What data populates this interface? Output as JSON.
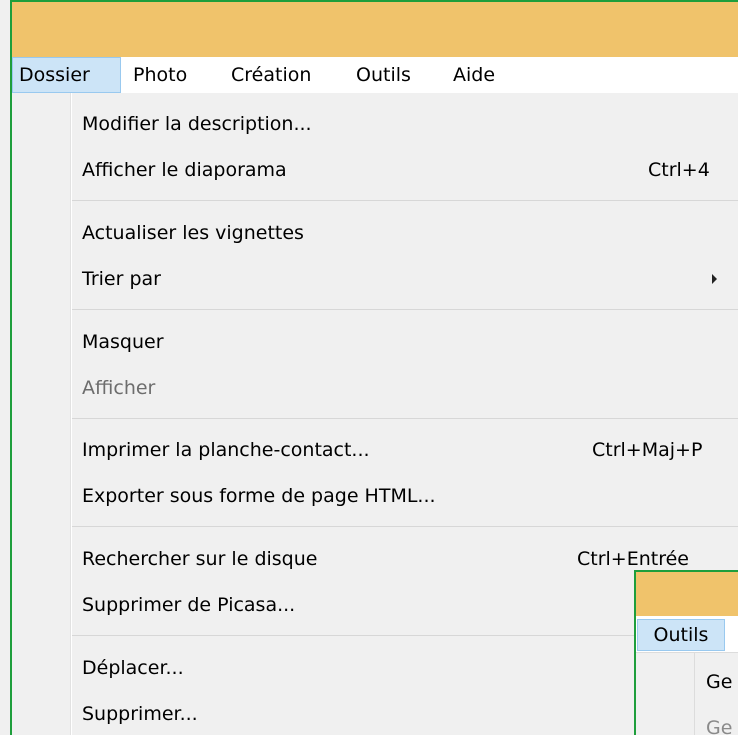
{
  "menubar": {
    "items": [
      {
        "label": "Dossier"
      },
      {
        "label": "Photo"
      },
      {
        "label": "Création"
      },
      {
        "label": "Outils"
      },
      {
        "label": "Aide"
      }
    ]
  },
  "dropdown": {
    "items": [
      {
        "label": "Modifier la description...",
        "shortcut": ""
      },
      {
        "label": "Afficher le diaporama",
        "shortcut": "Ctrl+4"
      },
      {
        "label": "Actualiser les vignettes",
        "shortcut": ""
      },
      {
        "label": "Trier par",
        "shortcut": ""
      },
      {
        "label": "Masquer",
        "shortcut": ""
      },
      {
        "label": "Afficher",
        "shortcut": ""
      },
      {
        "label": "Imprimer la planche-contact...",
        "shortcut": "Ctrl+Maj+P"
      },
      {
        "label": "Exporter sous forme de page HTML...",
        "shortcut": ""
      },
      {
        "label": "Rechercher sur le disque",
        "shortcut": "Ctrl+Entrée"
      },
      {
        "label": "Supprimer de Picasa...",
        "shortcut": ""
      },
      {
        "label": "Déplacer...",
        "shortcut": ""
      },
      {
        "label": "Supprimer...",
        "shortcut": ""
      }
    ]
  },
  "inset": {
    "menu_label": "Outils",
    "item1": "Ge",
    "item2": "Ge"
  },
  "colors": {
    "titlebar": "#f0c36b",
    "border": "#1e9e3c",
    "active_menu": "#cce4f7"
  }
}
